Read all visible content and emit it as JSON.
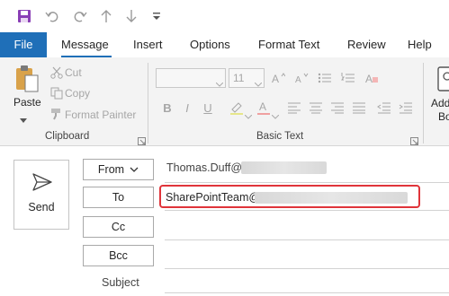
{
  "qat": {
    "icons": [
      "save-icon",
      "undo-icon",
      "redo-icon",
      "up-arrow-icon",
      "down-arrow-icon",
      "customize-icon"
    ]
  },
  "tabs": [
    {
      "label": "File"
    },
    {
      "label": "Message"
    },
    {
      "label": "Insert"
    },
    {
      "label": "Options"
    },
    {
      "label": "Format Text"
    },
    {
      "label": "Review"
    },
    {
      "label": "Help"
    }
  ],
  "clipboard": {
    "paste_label": "Paste",
    "cut_label": "Cut",
    "copy_label": "Copy",
    "format_painter_label": "Format Painter",
    "group_label": "Clipboard"
  },
  "basic_text": {
    "font_size": "11",
    "group_label": "Basic Text",
    "buttons": [
      "B",
      "I",
      "U"
    ]
  },
  "address_book": {
    "label_line1": "Add",
    "label_line2": "Bo"
  },
  "compose": {
    "send_label": "Send",
    "from_label": "From",
    "from_value": "Thomas.Duff@",
    "to_label": "To",
    "to_value": "SharePointTeam@",
    "cc_label": "Cc",
    "bcc_label": "Bcc",
    "subject_label": "Subject"
  },
  "colors": {
    "accent": "#1f6fb8",
    "highlight_box": "#e0343a"
  }
}
